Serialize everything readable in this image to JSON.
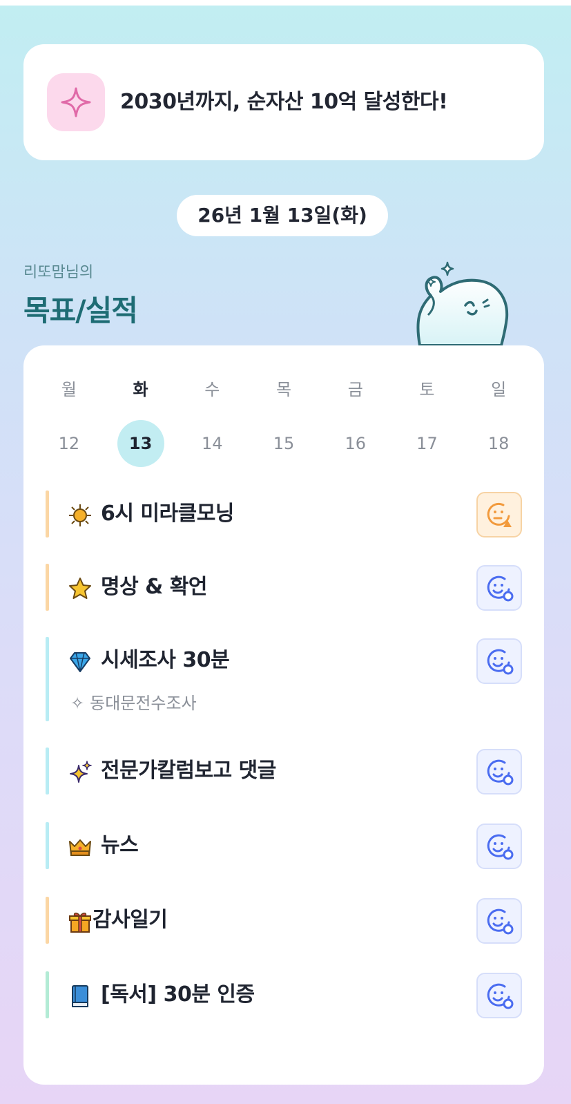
{
  "goal": {
    "text": "2030년까지, 순자산 10억 달성한다!",
    "icon": "sparkle-icon",
    "icon_bg": "#fcd9ec",
    "icon_color": "#e06aa8"
  },
  "date_label": "26년 1월 13일(화)",
  "owner_label": "리또맘님의",
  "section_title": "목표/실적",
  "week": {
    "days": [
      "월",
      "화",
      "수",
      "목",
      "금",
      "토",
      "일"
    ],
    "dates": [
      "12",
      "13",
      "14",
      "15",
      "16",
      "17",
      "18"
    ],
    "selected_index": 1
  },
  "tasks": [
    {
      "emoji": "sun-icon",
      "label": "6시 미라클모닝",
      "bar_color": "#fbd6a4",
      "status": "warning"
    },
    {
      "emoji": "star-icon",
      "label": "명상 & 확언",
      "bar_color": "#fbd6a4",
      "status": "done"
    },
    {
      "emoji": "gem-icon",
      "label": "시세조사 30분",
      "sub": "동대문전수조사",
      "bar_color": "#b8ecf4",
      "status": "done"
    },
    {
      "emoji": "sparkles-icon",
      "label": "전문가칼럼보고 댓글",
      "bar_color": "#b8ecf4",
      "status": "done"
    },
    {
      "emoji": "crown-icon",
      "label": "뉴스",
      "bar_color": "#b8ecf4",
      "status": "done"
    },
    {
      "emoji": "gift-icon",
      "label": "감사일기",
      "bar_color": "#fbd6a4",
      "status": "done"
    },
    {
      "emoji": "book-icon",
      "label": "[독서] 30분 인증",
      "bar_color": "#b3ebd5",
      "status": "done"
    }
  ],
  "colors": {
    "accent_teal": "#1e6c74",
    "selected_date_bg": "#c2edf2",
    "status_done": "#4a6cf0",
    "status_warning": "#f29a3c"
  }
}
